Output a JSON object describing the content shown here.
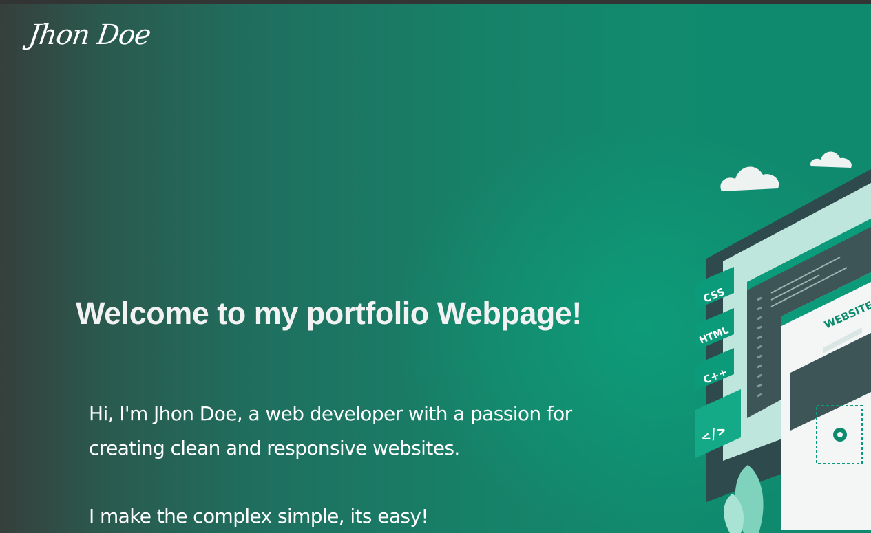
{
  "header": {
    "brand": "Jhon Doe"
  },
  "hero": {
    "headline": "Welcome to my portfolio Webpage!",
    "intro": "Hi, I'm Jhon Doe, a web developer with a passion for creating clean and responsive websites.",
    "tagline": "I make the complex simple, its easy!"
  },
  "illustration": {
    "screen_title": "WEBSITE",
    "tags": [
      "CSS",
      "HTML",
      "C++",
      "</>"
    ],
    "icons": [
      "cloud-icon",
      "gear-icon",
      "code-icon",
      "plant-icon"
    ]
  },
  "colors": {
    "accent": "#0f8a6e",
    "background_dark": "#363f3c",
    "text": "#ffffff"
  }
}
